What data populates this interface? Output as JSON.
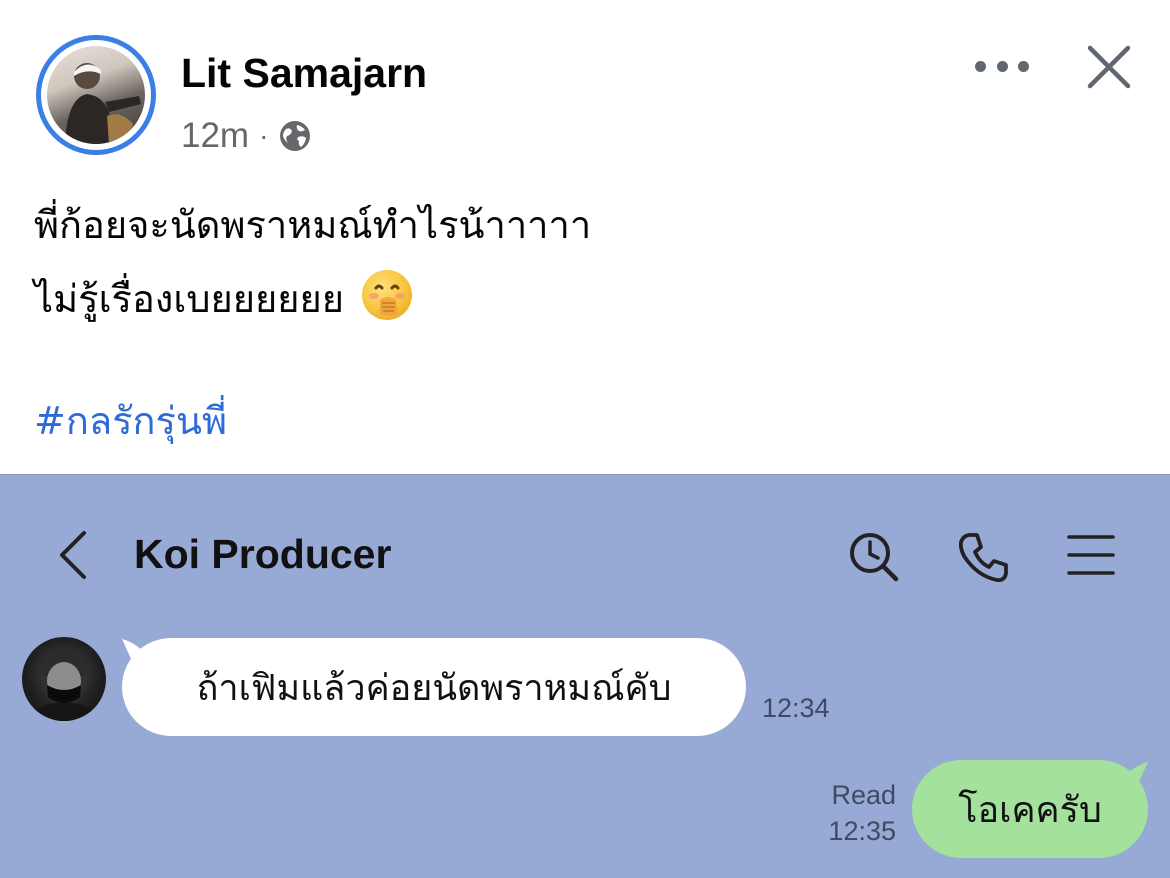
{
  "post": {
    "author": "Lit Samajarn",
    "time": "12m",
    "separator": "·",
    "privacy_icon": "globe-icon",
    "line1": "พี่ก้อยจะนัดพราหมณ์ทำไรน้าาาาา",
    "line2": "ไม่รู้เรื่องเบยยยยยย",
    "emoji": "face-with-hand-over-mouth",
    "hashtag": "#กลรักรุ่นพี่"
  },
  "header_actions": {
    "more_icon": "more-horizontal-icon",
    "close_icon": "close-icon"
  },
  "chat": {
    "title": "Koi Producer",
    "icons": [
      "back-chevron-icon",
      "search-history-icon",
      "phone-icon",
      "menu-icon"
    ],
    "incoming": {
      "text": "ถ้าเฟิมแล้วค่อยนัดพราหมณ์คับ",
      "time": "12:34"
    },
    "outgoing": {
      "text": "โอเคครับ",
      "status": "Read",
      "time": "12:35"
    },
    "colors": {
      "background": "#97a9d5",
      "incoming_bubble": "#ffffff",
      "outgoing_bubble": "#a4e19d"
    }
  },
  "colors": {
    "avatar_ring": "#3a7ee8",
    "hashtag": "#2f6bd6",
    "meta_text": "#65676b"
  }
}
